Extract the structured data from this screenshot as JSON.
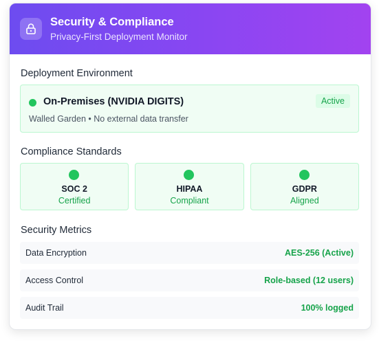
{
  "header": {
    "title": "Security & Compliance",
    "subtitle": "Privacy-First Deployment Monitor",
    "icon": "lock-icon",
    "gradient": [
      "#6d4cf0",
      "#a243f0"
    ]
  },
  "deployment": {
    "section_title": "Deployment Environment",
    "name": "On-Premises (NVIDIA DIGITS)",
    "description": "Walled Garden • No external data transfer",
    "badge": "Active",
    "status_color": "#22c55e"
  },
  "compliance": {
    "section_title": "Compliance Standards",
    "standards": [
      {
        "name": "SOC 2",
        "status": "Certified"
      },
      {
        "name": "HIPAA",
        "status": "Compliant"
      },
      {
        "name": "GDPR",
        "status": "Aligned"
      }
    ]
  },
  "metrics": {
    "section_title": "Security Metrics",
    "items": [
      {
        "label": "Data Encryption",
        "value": "AES-256 (Active)"
      },
      {
        "label": "Access Control",
        "value": "Role-based (12 users)"
      },
      {
        "label": "Audit Trail",
        "value": "100% logged"
      }
    ]
  }
}
